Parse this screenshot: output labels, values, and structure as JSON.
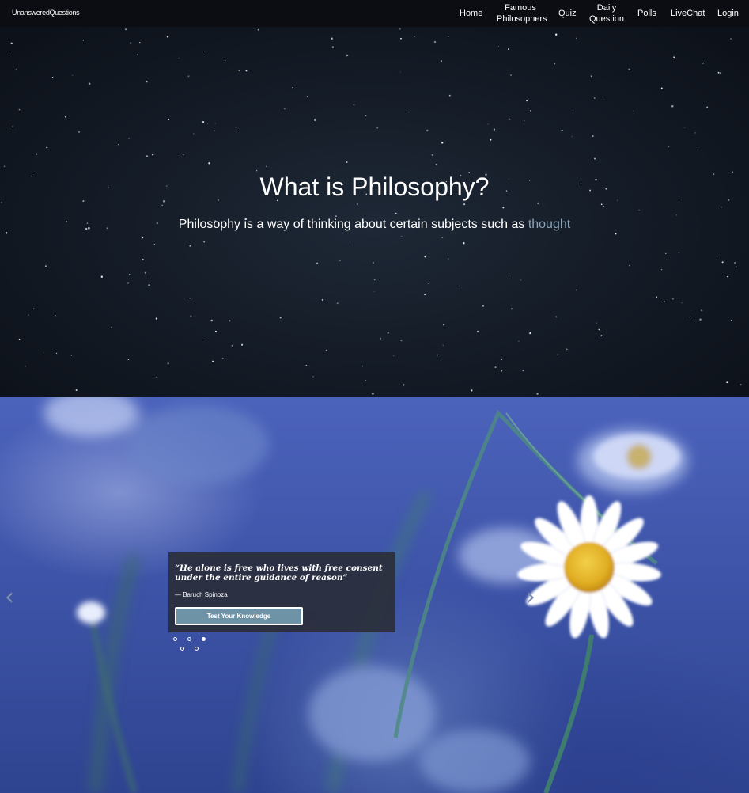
{
  "nav": {
    "brand": "UnansweredQuestions",
    "home": "Home",
    "famous_line1": "Famous",
    "famous_line2": "Philosophers",
    "quiz": "Quiz",
    "daily_line1": "Daily",
    "daily_line2": "Question",
    "polls": "Polls",
    "livechat": "LiveChat",
    "login": "Login"
  },
  "hero": {
    "title": "What is Philosophy?",
    "subtitle_text": "Philosophy is a way of thinking about certain subjects such as",
    "subtitle_highlight": "thought"
  },
  "carousel": {
    "quote": "“He alone is free who lives with free consent under the entire guidance of reason”",
    "author": "— Baruch Spinoza",
    "button_label": "Test Your Knowledge",
    "prev_icon": "‹",
    "next_icon": "›",
    "slide_count": 5,
    "active_slide": 3
  },
  "colors": {
    "accent_text": "#8aa3b8",
    "button_bg": "#6f93a6",
    "caption_bg": "#28282d"
  }
}
